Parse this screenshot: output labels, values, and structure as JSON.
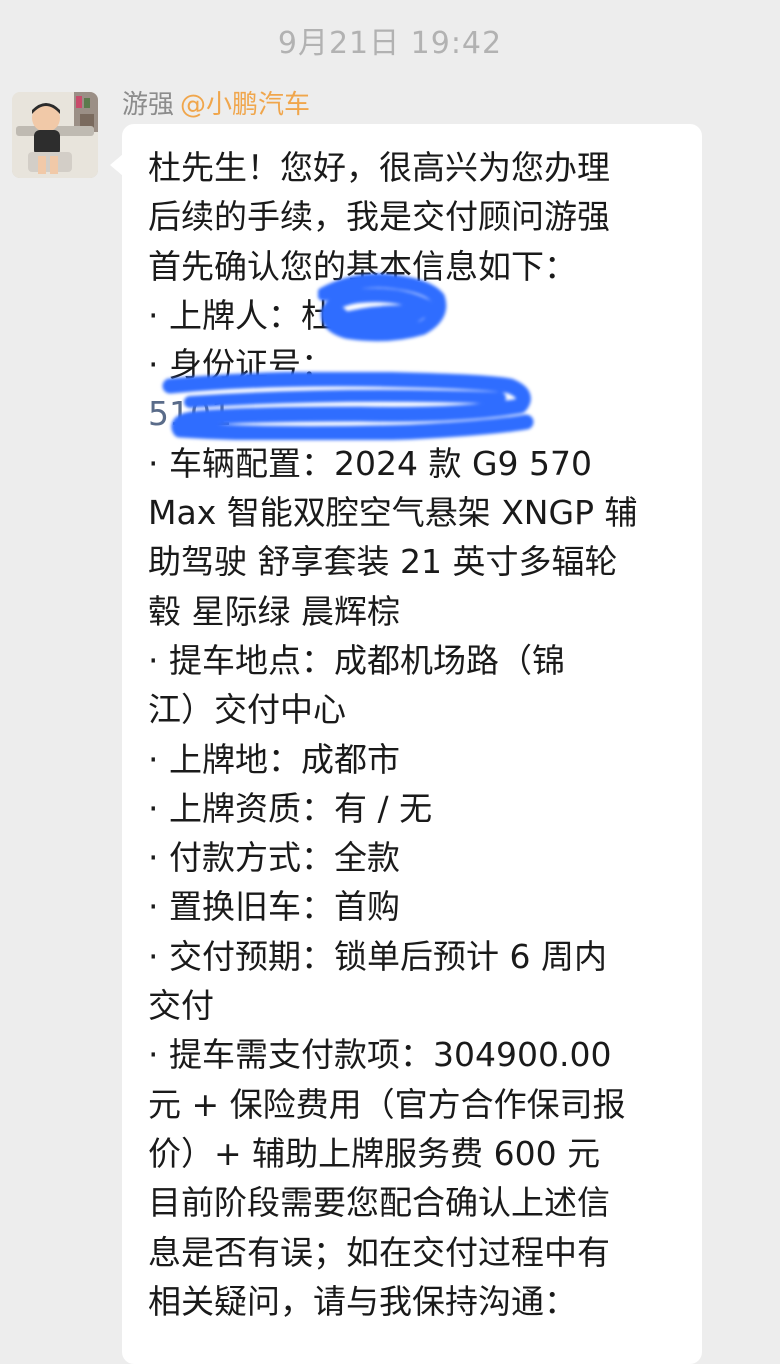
{
  "timestamp": "9月21日 19:42",
  "sender": {
    "name": "游强",
    "org": "@小鹏汽车"
  },
  "message": {
    "lines": [
      "杜先生！您好，很高兴为您办理",
      "后续的手续，我是交付顾问游强",
      "首先确认您的基本信息如下：",
      "· 上牌人：杜",
      "· 身份证号：",
      "5101",
      "· 车辆配置：2024 款 G9 570",
      "Max 智能双腔空气悬架 XNGP 辅",
      "助驾驶 舒享套装 21 英寸多辐轮",
      "毂 星际绿 晨辉棕",
      "· 提车地点：成都机场路（锦",
      "江）交付中心",
      "· 上牌地：成都市",
      "· 上牌资质：有 / 无",
      "· 付款方式：全款",
      "· 置换旧车：首购",
      "· 交付预期：锁单后预计 6 周内",
      "交付",
      "· 提车需支付款项：304900.00",
      "元 + 保险费用（官方合作保司报",
      "价）+ 辅助上牌服务费 600 元",
      "目前阶段需要您配合确认上述信",
      "息是否有误；如在交付过程中有",
      "相关疑问，请与我保持沟通："
    ]
  },
  "colors": {
    "background": "#ededed",
    "bubble": "#ffffff",
    "org_accent": "#f0a64c",
    "redaction": "#2f6dff"
  },
  "icons": {
    "avatar": "avatar-photo-child-in-high-chair"
  }
}
